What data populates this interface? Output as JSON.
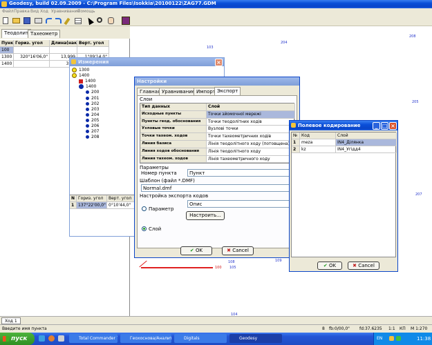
{
  "app": {
    "title": "Geodesy, build 02.09.2009 - C:\\Program Files\\Isokkia\\20100122\\ZAG77.GDM",
    "menu": [
      "Файл",
      "Правка",
      "Вид",
      "Ход",
      "Уравнивание",
      "Помощь"
    ],
    "toolbar_icons": [
      "new-file-icon",
      "open-folder-icon",
      "save-icon",
      "print-icon",
      "undo-icon",
      "redo-icon",
      "edit-icon",
      "table-icon",
      "pointer-icon",
      "zoom-icon",
      "hand-icon",
      "chart-icon"
    ]
  },
  "left_panel": {
    "tabs": [
      "Теодолит",
      "Тахеометр"
    ],
    "columns": [
      "Пункт",
      "Гориз. угол",
      "Длина(накл)",
      "Верт. угол"
    ],
    "rows": [
      {
        "point": "100",
        "hz": "",
        "length": "",
        "vert": ""
      },
      {
        "point": "1300",
        "hz": "320°16'06,0\"",
        "length": "13,999",
        "vert": "1°09'14,0\""
      },
      {
        "point": "1400",
        "hz": "",
        "length": "37,6",
        "vert": ""
      }
    ],
    "bottom_tab": "Ход 1"
  },
  "measurements_window": {
    "title": "Измерения",
    "tree": [
      {
        "label": "1300",
        "level": 0,
        "icon": "yellow-circle"
      },
      {
        "label": "1400",
        "level": 0,
        "icon": "yellow-circle"
      },
      {
        "label": "1400",
        "level": 1,
        "icon": "red-square"
      },
      {
        "label": "1400",
        "level": 1,
        "icon": "blue-circle"
      },
      {
        "label": "200",
        "level": 2,
        "icon": "blue-dot"
      },
      {
        "label": "201",
        "level": 2,
        "icon": "blue-dot"
      },
      {
        "label": "202",
        "level": 2,
        "icon": "blue-dot"
      },
      {
        "label": "203",
        "level": 2,
        "icon": "blue-dot"
      },
      {
        "label": "204",
        "level": 2,
        "icon": "blue-dot"
      },
      {
        "label": "205",
        "level": 2,
        "icon": "blue-dot"
      },
      {
        "label": "206",
        "level": 2,
        "icon": "blue-dot"
      },
      {
        "label": "207",
        "level": 2,
        "icon": "blue-dot"
      },
      {
        "label": "208",
        "level": 2,
        "icon": "blue-dot"
      }
    ],
    "grid_columns": [
      "N",
      "Гориз. угол",
      "Верт. угол"
    ],
    "grid_row": {
      "n": "1",
      "hz": "137°22'00,0\"",
      "vert": "0°10'44,0\""
    }
  },
  "settings_dialog": {
    "title": "Настройки",
    "tabs": [
      "Главная",
      "Уравнивание",
      "Импорт",
      "Экспорт"
    ],
    "layers_group": "Слои",
    "layers_header": [
      "Тип данных",
      "Слой"
    ],
    "layers": [
      {
        "type": "Исходные пункты",
        "layer": "Точки зйомочної мережі",
        "selected": true
      },
      {
        "type": "Пункты геод. обоснования",
        "layer": "Точки теодолітних ходів",
        "selected": false
      },
      {
        "type": "Узловые точки",
        "layer": "Вузлові точки",
        "selected": false
      },
      {
        "type": "Точки тахеом. ходов",
        "layer": "Точки тахеометричних ходів",
        "selected": false
      },
      {
        "type": "Линия базиса",
        "layer": "Лінія теодолітного ходу (потовщена)",
        "selected": false
      },
      {
        "type": "Линия ходов обоснования",
        "layer": "Лінія теодолітного ходу",
        "selected": false
      },
      {
        "type": "Линия тахеом. ходов",
        "layer": "Лінія тахеометричного ходу",
        "selected": false
      }
    ],
    "params_group": "Параметры",
    "point_number_label": "Номер пункта",
    "point_number_value": "Пункт",
    "template_group": "Шаблон (файл *.DMF)",
    "template_value": "Normal.dmf",
    "export_codes_group": "Настройка экспорта кодов",
    "option_param": "Параметр",
    "option_layer": "Слой",
    "description_value": "Опис",
    "configure_button": "Настроить...",
    "ok": "OK",
    "cancel": "Cancel"
  },
  "field_coding_dialog": {
    "title": "Полевое кодирование",
    "columns": [
      "№",
      "Код",
      "Слой"
    ],
    "rows": [
      {
        "n": "1",
        "code": "meza",
        "layer": "IN4_Ділянка"
      },
      {
        "n": "2",
        "code": "kz",
        "layer": "IN4_Угідд4"
      }
    ],
    "ok": "OK",
    "cancel": "Cancel"
  },
  "map_labels": [
    "208",
    "103",
    "204",
    "205",
    "207",
    "109",
    "108",
    "100",
    "105",
    "104"
  ],
  "status_bar": {
    "hint": "Введите имя пункта",
    "items": [
      "8",
      "fb:0/00,0\"",
      "fd:37.6235",
      "1:1",
      "КП",
      "М 1:270"
    ]
  },
  "taskbar": {
    "start": "пуск",
    "buttons": [
      "Total Commander 7.0...",
      "Геохоснова/Аналит...",
      "Digitals",
      "Geodesy"
    ],
    "lang": "EN",
    "clock": "11:38"
  },
  "colors": {
    "selection": "#aab8dc",
    "xp_blue": "#0a4fd8",
    "taskbar": "#2456d6",
    "start": "#3c9a2c"
  }
}
